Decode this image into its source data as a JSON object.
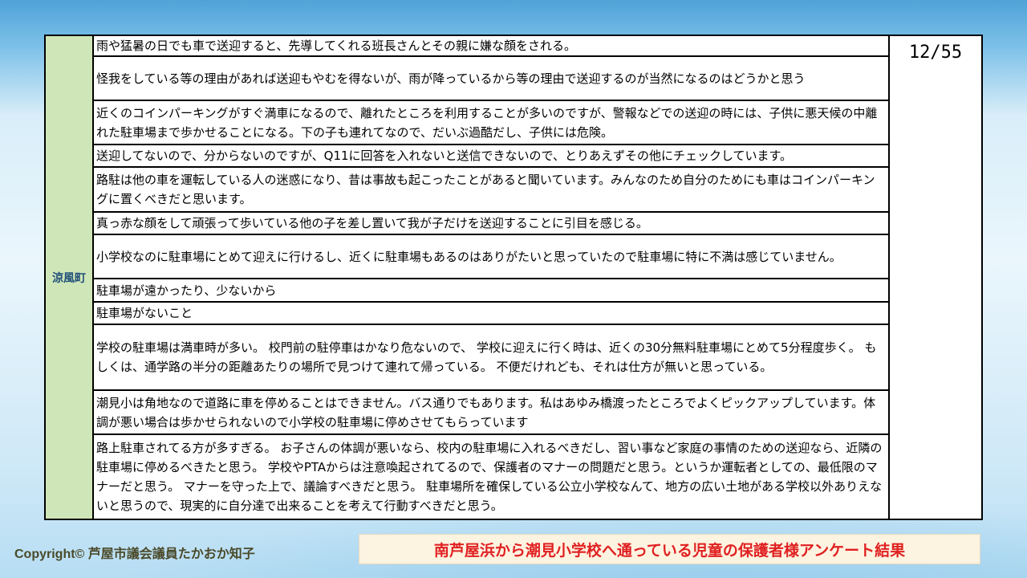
{
  "region": "涼風町",
  "page_indicator": "12/55",
  "rows": [
    "雨や猛暑の日でも車で送迎すると、先導してくれる班長さんとその親に嫌な顔をされる。",
    "怪我をしている等の理由があれば送迎もやむを得ないが、雨が降っているから等の理由で送迎するのが当然になるのはどうかと思う",
    "近くのコインパーキングがすぐ満車になるので、離れたところを利用することが多いのですが、警報などでの送迎の時には、子供に悪天候の中離れた駐車場まで歩かせることになる。下の子も連れてなので、だいぶ過酷だし、子供には危険。",
    "送迎してないので、分からないのですが、Q11に回答を入れないと送信できないので、とりあえずその他にチェックしています。",
    "路駐は他の車を運転している人の迷惑になり、昔は事故も起こったことがあると聞いています。みんなのため自分のためにも車はコインパーキングに置くべきだと思います。",
    "真っ赤な顔をして頑張って歩いている他の子を差し置いて我が子だけを送迎することに引目を感じる。",
    "小学校なのに駐車場にとめて迎えに行けるし、近くに駐車場もあるのはありがたいと思っていたので駐車場に特に不満は感じていません。",
    "駐車場が遠かったり、少ないから",
    "駐車場がないこと",
    "学校の駐車場は満車時が多い。 校門前の駐停車はかなり危ないので、 学校に迎えに行く時は、近くの30分無料駐車場にとめて5分程度歩く。 もしくは、通学路の半分の距離あたりの場所で見つけて連れて帰っている。 不便だけれども、それは仕方が無いと思っている。",
    "潮見小は角地なので道路に車を停めることはできません。バス通りでもあります。私はあゆみ橋渡ったところでよくピックアップしています。体調が悪い場合は歩かせられないので小学校の駐車場に停めさせてもらっています",
    "路上駐車されてる方が多すぎる。 お子さんの体調が悪いなら、校内の駐車場に入れるべきだし、習い事など家庭の事情のための送迎なら、近隣の駐車場に停めるべきたと思う。 学校やPTAからは注意喚起されてるので、保護者のマナーの問題だと思う。というか運転者としての、最低限のマナーだと思う。 マナーを守った上で、議論すべきだと思う。 駐車場所を確保している公立小学校なんて、地方の広い土地がある学校以外ありえないと思うので、現実的に自分達で出来ることを考えて行動すべきだと思う。"
  ],
  "copyright": "Copyright© 芦屋市議会議員たかおか知子",
  "footer_title": "南芦屋浜から潮見小学校へ通っている児童の保護者様アンケート結果"
}
